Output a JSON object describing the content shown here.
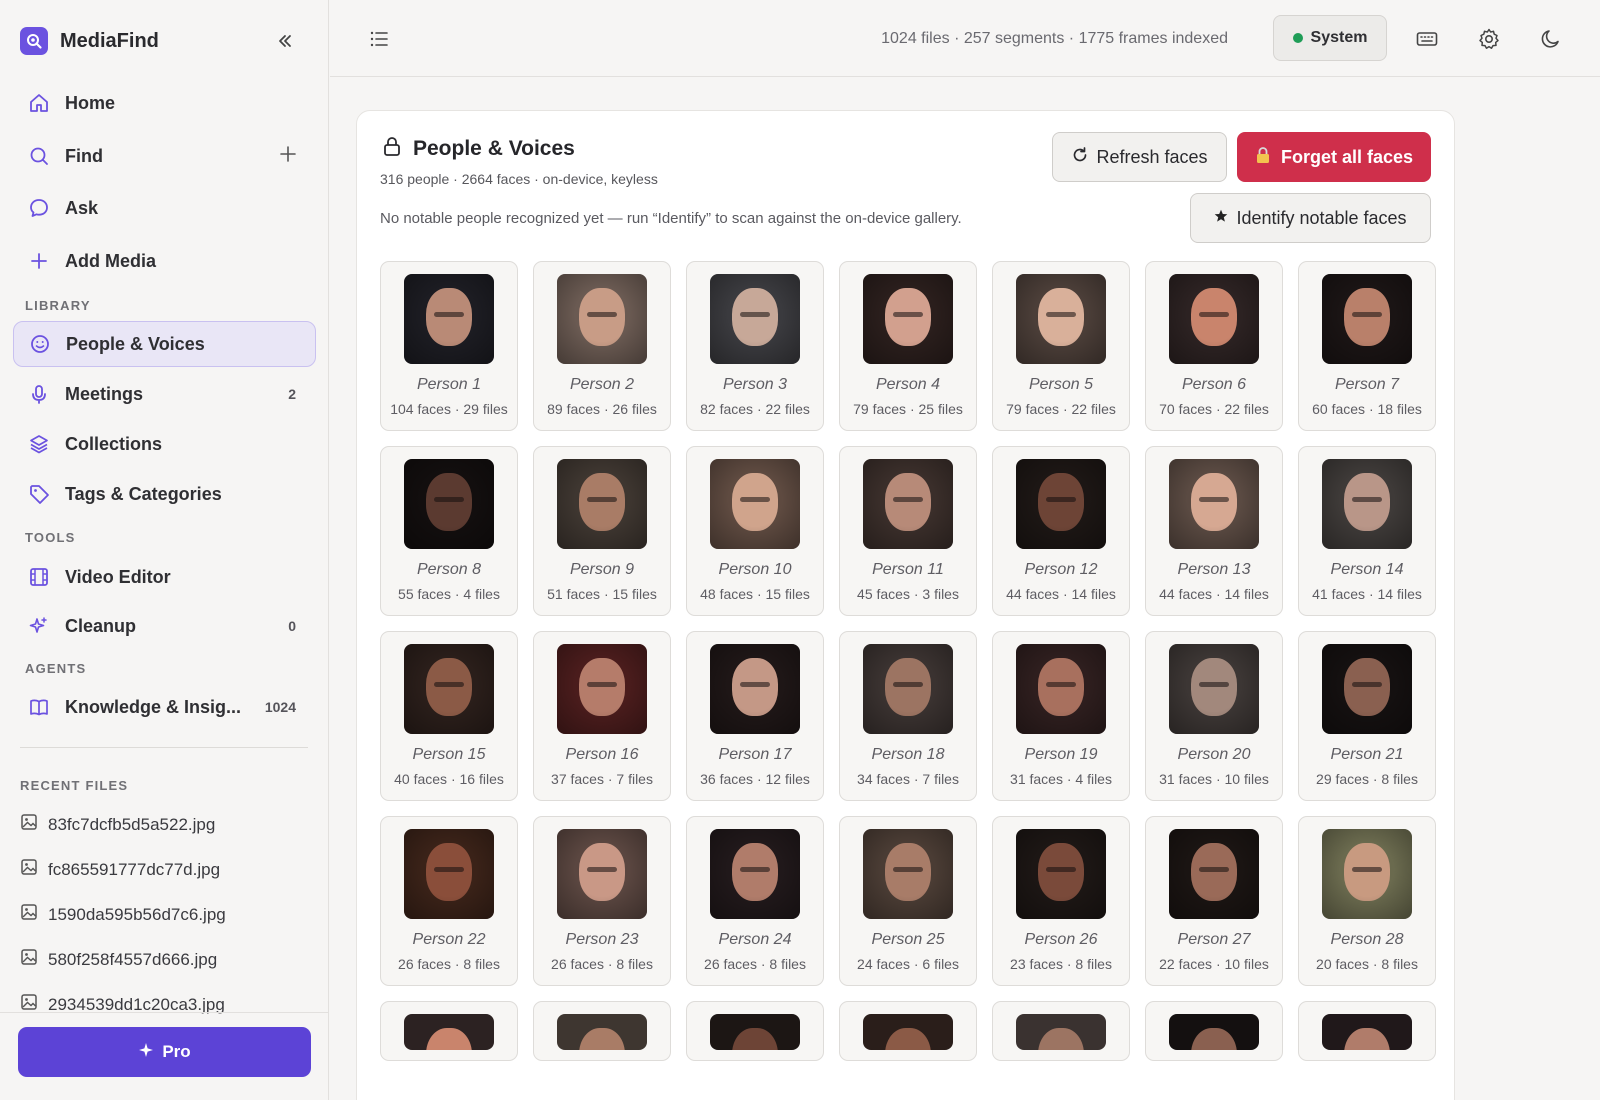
{
  "app": {
    "name": "MediaFind",
    "brand_color": "#6b52e0"
  },
  "sidebar": {
    "nav": [
      {
        "label": "Home",
        "icon": "home-icon"
      },
      {
        "label": "Find",
        "icon": "search-icon"
      },
      {
        "label": "Ask",
        "icon": "chat-bubble-icon"
      },
      {
        "label": "Add Media",
        "icon": "plus-icon"
      }
    ],
    "library_label": "LIBRARY",
    "library": [
      {
        "label": "People & Voices",
        "icon": "smiley-icon",
        "active": true
      },
      {
        "label": "Meetings",
        "icon": "microphone-icon",
        "count": "2"
      },
      {
        "label": "Collections",
        "icon": "layers-icon"
      },
      {
        "label": "Tags & Categories",
        "icon": "tag-icon"
      }
    ],
    "tools_label": "TOOLS",
    "tools": [
      {
        "label": "Video Editor",
        "icon": "film-icon"
      },
      {
        "label": "Cleanup",
        "icon": "sparkle-icon",
        "count": "0"
      }
    ],
    "agents_label": "AGENTS",
    "agents": [
      {
        "label": "Knowledge & Insig...",
        "icon": "book-icon",
        "count": "1024"
      }
    ],
    "recent_label": "RECENT FILES",
    "recent": [
      "83fc7dcfb5d5a522.jpg",
      "fc865591777dc77d.jpg",
      "1590da595b56d7c6.jpg",
      "580f258f4557d666.jpg",
      "2934539dd1c20ca3.jpg"
    ],
    "pro_label": "Pro"
  },
  "topbar": {
    "stats": "1024 files · 257 segments · 1775 frames indexed",
    "system_label": "System",
    "system_status_color": "#1f9d57"
  },
  "panel": {
    "title": "People & Voices",
    "subtitle": "316 people · 2664 faces · on-device, keyless",
    "note": "No notable people recognized yet — run “Identify” to scan against the on-device gallery.",
    "refresh_label": "Refresh faces",
    "forget_label": "Forget all faces",
    "forget_color": "#cf2f4b",
    "identify_label": "Identify notable faces",
    "people": [
      {
        "name": "Person 1",
        "meta": "104 faces · 29 files"
      },
      {
        "name": "Person 2",
        "meta": "89 faces · 26 files"
      },
      {
        "name": "Person 3",
        "meta": "82 faces · 22 files"
      },
      {
        "name": "Person 4",
        "meta": "79 faces · 25 files"
      },
      {
        "name": "Person 5",
        "meta": "79 faces · 22 files"
      },
      {
        "name": "Person 6",
        "meta": "70 faces · 22 files"
      },
      {
        "name": "Person 7",
        "meta": "60 faces · 18 files"
      },
      {
        "name": "Person 8",
        "meta": "55 faces · 4 files"
      },
      {
        "name": "Person 9",
        "meta": "51 faces · 15 files"
      },
      {
        "name": "Person 10",
        "meta": "48 faces · 15 files"
      },
      {
        "name": "Person 11",
        "meta": "45 faces · 3 files"
      },
      {
        "name": "Person 12",
        "meta": "44 faces · 14 files"
      },
      {
        "name": "Person 13",
        "meta": "44 faces · 14 files"
      },
      {
        "name": "Person 14",
        "meta": "41 faces · 14 files"
      },
      {
        "name": "Person 15",
        "meta": "40 faces · 16 files"
      },
      {
        "name": "Person 16",
        "meta": "37 faces · 7 files"
      },
      {
        "name": "Person 17",
        "meta": "36 faces · 12 files"
      },
      {
        "name": "Person 18",
        "meta": "34 faces · 7 files"
      },
      {
        "name": "Person 19",
        "meta": "31 faces · 4 files"
      },
      {
        "name": "Person 20",
        "meta": "31 faces · 10 files"
      },
      {
        "name": "Person 21",
        "meta": "29 faces · 8 files"
      },
      {
        "name": "Person 22",
        "meta": "26 faces · 8 files"
      },
      {
        "name": "Person 23",
        "meta": "26 faces · 8 files"
      },
      {
        "name": "Person 24",
        "meta": "26 faces · 8 files"
      },
      {
        "name": "Person 25",
        "meta": "24 faces · 6 files"
      },
      {
        "name": "Person 26",
        "meta": "23 faces · 8 files"
      },
      {
        "name": "Person 27",
        "meta": "22 faces · 10 files"
      },
      {
        "name": "Person 28",
        "meta": "20 faces · 8 files"
      }
    ]
  }
}
